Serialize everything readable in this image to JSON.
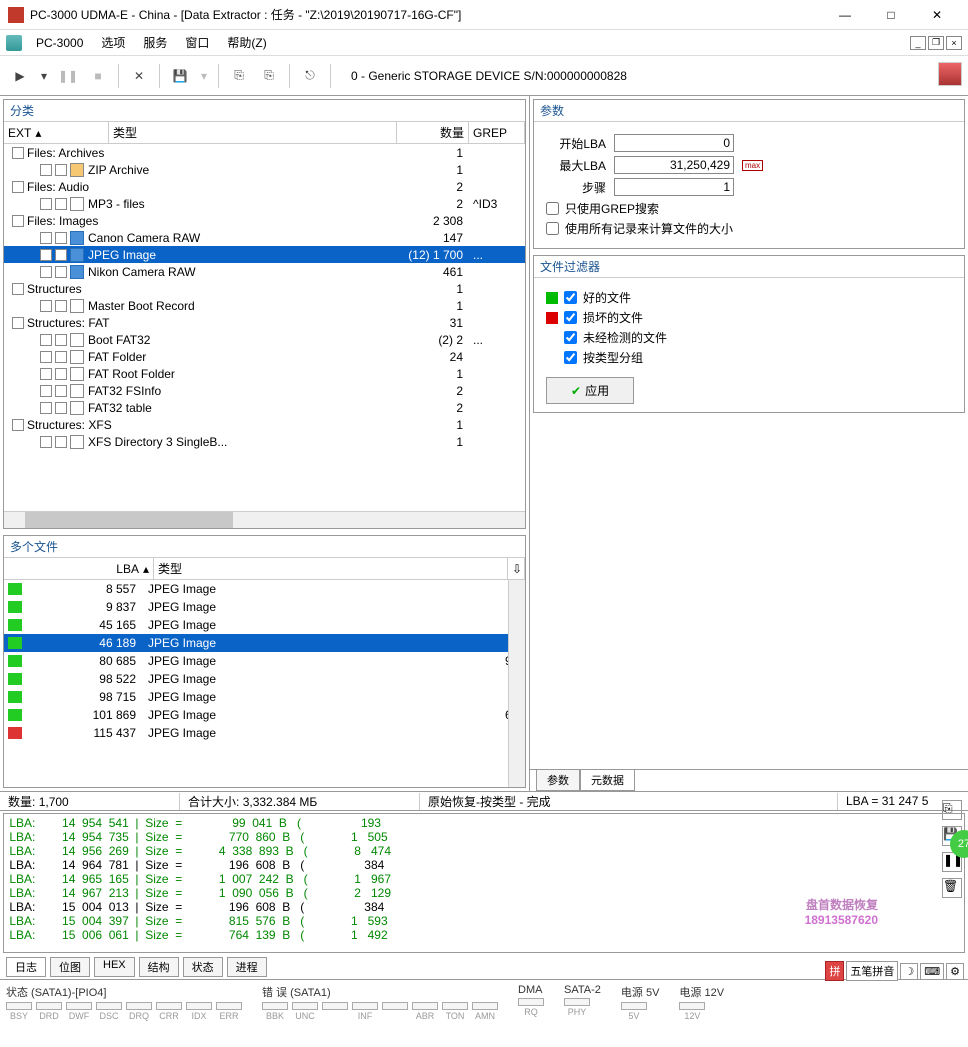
{
  "window": {
    "title": "PC-3000 UDMA-E - China - [Data Extractor : 任务 - \"Z:\\2019\\20190717-16G-CF\"]"
  },
  "menubar": {
    "app": "PC-3000",
    "items": [
      "选项",
      "服务",
      "窗口",
      "帮助(Z)"
    ]
  },
  "toolbar": {
    "device": "0 - Generic STORAGE DEVICE  S/N:000000000828"
  },
  "tree": {
    "title": "分类",
    "headers": {
      "ext": "EXT",
      "type": "类型",
      "count": "数量",
      "grep": "GREP"
    },
    "rows": [
      {
        "indent": 0,
        "name": "Files: Archives",
        "count": "1",
        "grep": "",
        "icon": ""
      },
      {
        "indent": 1,
        "name": "ZIP Archive",
        "count": "1",
        "grep": "",
        "icon": "zip"
      },
      {
        "indent": 0,
        "name": "Files: Audio",
        "count": "2",
        "grep": "",
        "icon": ""
      },
      {
        "indent": 1,
        "name": "MP3 - files",
        "count": "2",
        "grep": "^ID3",
        "icon": "f"
      },
      {
        "indent": 0,
        "name": "Files: Images",
        "count": "2 308",
        "grep": "",
        "icon": ""
      },
      {
        "indent": 1,
        "name": "Canon Camera RAW",
        "count": "147",
        "grep": "",
        "icon": "jpeg"
      },
      {
        "indent": 1,
        "name": "JPEG Image",
        "count": "(12) 1 700",
        "grep": "...",
        "icon": "jpeg",
        "sel": true
      },
      {
        "indent": 1,
        "name": "Nikon Camera RAW",
        "count": "461",
        "grep": "",
        "icon": "jpeg"
      },
      {
        "indent": 0,
        "name": "Structures",
        "count": "1",
        "grep": "",
        "icon": ""
      },
      {
        "indent": 1,
        "name": "Master Boot Record",
        "count": "1",
        "grep": "",
        "icon": "f"
      },
      {
        "indent": 0,
        "name": "Structures: FAT",
        "count": "31",
        "grep": "",
        "icon": ""
      },
      {
        "indent": 1,
        "name": "Boot FAT32",
        "count": "(2) 2",
        "grep": "...",
        "icon": "f"
      },
      {
        "indent": 1,
        "name": "FAT Folder",
        "count": "24",
        "grep": "",
        "icon": "f"
      },
      {
        "indent": 1,
        "name": "FAT Root Folder",
        "count": "1",
        "grep": "",
        "icon": "f"
      },
      {
        "indent": 1,
        "name": "FAT32 FSInfo",
        "count": "2",
        "grep": "",
        "icon": "f"
      },
      {
        "indent": 1,
        "name": "FAT32 table",
        "count": "2",
        "grep": "",
        "icon": "f"
      },
      {
        "indent": 0,
        "name": "Structures: XFS",
        "count": "1",
        "grep": "",
        "icon": ""
      },
      {
        "indent": 1,
        "name": "XFS Directory 3 SingleB...",
        "count": "1",
        "grep": "",
        "icon": "f"
      }
    ]
  },
  "files": {
    "title": "多个文件",
    "headers": {
      "lba": "LBA",
      "type": "类型"
    },
    "rows": [
      {
        "color": "#2c2",
        "lba": "8 557",
        "type": "JPEG Image",
        "r": ""
      },
      {
        "color": "#2c2",
        "lba": "9 837",
        "type": "JPEG Image",
        "r": ""
      },
      {
        "color": "#2c2",
        "lba": "45 165",
        "type": "JPEG Image",
        "r": ""
      },
      {
        "color": "#2c2",
        "lba": "46 189",
        "type": "JPEG Image",
        "r": "",
        "sel": true
      },
      {
        "color": "#2c2",
        "lba": "80 685",
        "type": "JPEG Image",
        "r": "9"
      },
      {
        "color": "#2c2",
        "lba": "98 522",
        "type": "JPEG Image",
        "r": ""
      },
      {
        "color": "#2c2",
        "lba": "98 715",
        "type": "JPEG Image",
        "r": ""
      },
      {
        "color": "#2c2",
        "lba": "101 869",
        "type": "JPEG Image",
        "r": "6"
      },
      {
        "color": "#d33",
        "lba": "115 437",
        "type": "JPEG Image",
        "r": ""
      }
    ]
  },
  "params": {
    "title": "参数",
    "startLBA": {
      "label": "开始LBA",
      "value": "0"
    },
    "maxLBA": {
      "label": "最大LBA",
      "value": "31,250,429"
    },
    "step": {
      "label": "步骤",
      "value": "1"
    },
    "grepOnly": "只使用GREP搜索",
    "allRecords": "使用所有记录来计算文件的大小"
  },
  "filter": {
    "title": "文件过滤器",
    "good": "好的文件",
    "bad": "损坏的文件",
    "untested": "未经检测的文件",
    "byType": "按类型分组",
    "apply": "应用"
  },
  "rtabs": {
    "params": "参数",
    "meta": "元数据"
  },
  "status": {
    "count_label": "数量:",
    "count": "1,700",
    "size_label": "合计大小:",
    "size": "3,332.384 МБ",
    "op": "原始恢复-按类型 - 完成",
    "lba": "LBA = 31 247 5"
  },
  "log": {
    "lines": [
      {
        "c": "g",
        "t": " LBA:        14  954  541  |  Size  =               99  041  B   (                  193"
      },
      {
        "c": "g",
        "t": " LBA:        14  954  735  |  Size  =              770  860  B   (              1   505"
      },
      {
        "c": "g",
        "t": " LBA:        14  956  269  |  Size  =           4  338  893  B   (              8   474"
      },
      {
        "c": "b",
        "t": " LBA:        14  964  781  |  Size  =              196  608  B   (                  384"
      },
      {
        "c": "g",
        "t": " LBA:        14  965  165  |  Size  =           1  007  242  B   (              1   967"
      },
      {
        "c": "g",
        "t": " LBA:        14  967  213  |  Size  =           1  090  056  B   (              2   129"
      },
      {
        "c": "b",
        "t": " LBA:        15  004  013  |  Size  =              196  608  B   (                  384"
      },
      {
        "c": "g",
        "t": " LBA:        15  004  397  |  Size  =              815  576  B   (              1   593"
      },
      {
        "c": "g",
        "t": " LBA:        15  006  061  |  Size  =              764  139  B   (              1   492"
      }
    ],
    "tabs": [
      "日志",
      "位图",
      "HEX",
      "结构",
      "状态",
      "进程"
    ]
  },
  "hw": {
    "sata1": {
      "label": "状态 (SATA1)-[PIO4]",
      "leds": [
        "BSY",
        "DRD",
        "DWF",
        "DSC",
        "DRQ",
        "CRR",
        "IDX",
        "ERR"
      ]
    },
    "err": {
      "label": "错 误 (SATA1)",
      "leds": [
        "BBK",
        "UNC",
        "",
        "INF",
        "",
        "ABR",
        "TON",
        "AMN"
      ]
    },
    "dma": {
      "label": "DMA",
      "leds": [
        "RQ"
      ]
    },
    "sata2": {
      "label": "SATA-2",
      "leds": [
        "PHY"
      ]
    },
    "p5": {
      "label": "电源 5V",
      "leds": [
        "5V"
      ]
    },
    "p12": {
      "label": "电源 12V",
      "leds": [
        "12V"
      ]
    }
  },
  "watermark": {
    "l1": "盘首数据恢复",
    "l2": "18913587620"
  },
  "ime": {
    "label": "五笔拼音"
  },
  "badge": "27"
}
